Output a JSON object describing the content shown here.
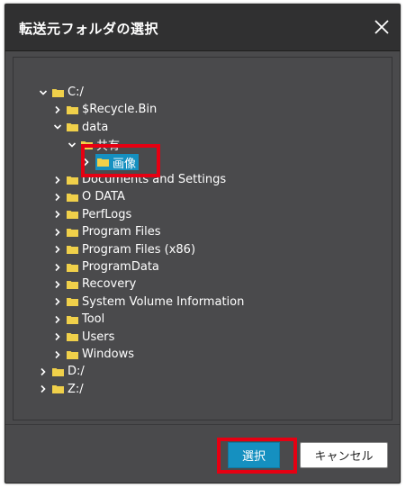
{
  "dialog": {
    "title": "転送元フォルダの選択",
    "close_icon": "close-icon"
  },
  "colors": {
    "titlebar_bg": "#303031",
    "body_bg": "#4a4a4c",
    "accent": "#1590c0",
    "highlight_red": "#e60012",
    "folder_yellow": "#f0d04a"
  },
  "tree": [
    {
      "label": "C:/",
      "expanded": true,
      "depth": 0
    },
    {
      "label": "$Recycle.Bin",
      "expanded": false,
      "depth": 1
    },
    {
      "label": "data",
      "expanded": true,
      "depth": 1
    },
    {
      "label": "共有",
      "expanded": true,
      "depth": 2
    },
    {
      "label": "画像",
      "expanded": false,
      "depth": 3,
      "selected": true
    },
    {
      "label": "Documents and Settings",
      "expanded": false,
      "depth": 1
    },
    {
      "label": "O DATA",
      "expanded": false,
      "depth": 1
    },
    {
      "label": "PerfLogs",
      "expanded": false,
      "depth": 1
    },
    {
      "label": "Program Files",
      "expanded": false,
      "depth": 1
    },
    {
      "label": "Program Files (x86)",
      "expanded": false,
      "depth": 1
    },
    {
      "label": "ProgramData",
      "expanded": false,
      "depth": 1
    },
    {
      "label": "Recovery",
      "expanded": false,
      "depth": 1
    },
    {
      "label": "System Volume Information",
      "expanded": false,
      "depth": 1
    },
    {
      "label": "Tool",
      "expanded": false,
      "depth": 1
    },
    {
      "label": "Users",
      "expanded": false,
      "depth": 1
    },
    {
      "label": "Windows",
      "expanded": false,
      "depth": 1
    },
    {
      "label": "D:/",
      "expanded": false,
      "depth": 0
    },
    {
      "label": "Z:/",
      "expanded": false,
      "depth": 0
    }
  ],
  "buttons": {
    "select_label": "選択",
    "cancel_label": "キャンセル"
  }
}
